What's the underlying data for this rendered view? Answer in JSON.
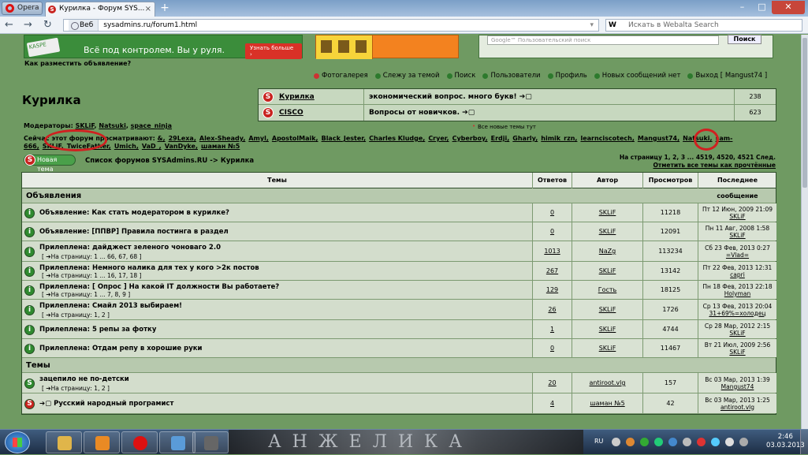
{
  "browser": {
    "opera_label": "Opera",
    "tab_title": "Курилка - Форум SYS...",
    "tab_close": "×",
    "new_tab": "+",
    "address_scheme": "Веб",
    "address": "sysadmins.ru/forum1.html",
    "search_engine": "W",
    "search_placeholder": "Искать в Webalta Search",
    "window_controls": {
      "minimize": "–",
      "maximize": "□",
      "close": "✕"
    },
    "nav": {
      "back": "←",
      "forward": "→",
      "reload": "↻"
    }
  },
  "ads": {
    "green_logo": "KASPE",
    "green_title": "Всё под контролем. Вы у руля.",
    "green_button": "Узнать больше ›",
    "how_to_place": "Как разместить объявление?",
    "google_placeholder": "Google™ Пользовательский поиск",
    "google_button": "Поиск"
  },
  "topnav": [
    {
      "label": "Фотогалерея",
      "dot": "r"
    },
    {
      "label": "Слежу за темой",
      "dot": "g"
    },
    {
      "label": "Поиск",
      "dot": "g"
    },
    {
      "label": "Пользователи",
      "dot": "g"
    },
    {
      "label": "Профиль",
      "dot": "g"
    },
    {
      "label": "Новых сообщений нет",
      "dot": "g"
    },
    {
      "label": "Выход [ Mangust74 ]",
      "dot": "g"
    }
  ],
  "forum_title": "Курилка",
  "subforums": [
    {
      "name": "Курилка",
      "last": "экономический вопрос. много букв! ➔▢",
      "count": "238"
    },
    {
      "name": "CISCO",
      "last": "Вопросы от новичков. ➔▢",
      "count": "623"
    }
  ],
  "new_topics_note": "Все новые темы тут",
  "moderators_label": "Модераторы:",
  "moderators": [
    "SKLiF",
    "Natsuki",
    "space_ninja"
  ],
  "viewers_label": "Сейчас этот форум просматривают:",
  "viewers": [
    "&",
    "29Lexa",
    "Alex-Sheady",
    "Amyl",
    "ApostolMaik",
    "Black_Jester",
    "Charles Kludge",
    "Cryer",
    "Cyberboy",
    "Erdji",
    "Gharly",
    "himik_rzn",
    "learnciscotech",
    "Mangust74",
    "Natsuki",
    "sam-666",
    "SKLiF",
    "TwiceFather",
    "Umich",
    "VaD_",
    "VanDyke",
    "шаман №5"
  ],
  "new_topic_label": "Новая тема",
  "breadcrumb": "Список форумов SYSAdmins.RU -> Курилка",
  "pager": {
    "text": "На страницу 1, 2, 3 ... 4519, 4520, 4521 След.",
    "mark_read": "Отметить все темы как прочтённые"
  },
  "columns": {
    "topics": "Темы",
    "replies": "Ответов",
    "author": "Автор",
    "views": "Просмотров",
    "last": "Последнее сообщение"
  },
  "section_announcements": "Объявления",
  "section_topics": "Темы",
  "rows": [
    {
      "icon": "i",
      "color": "g",
      "title": "Объявление: Как стать модератором в курилке?",
      "pages": "",
      "replies": "0",
      "author": "SKLiF",
      "views": "11218",
      "last_date": "Пт 12 Июн, 2009 21:09",
      "last_user": "SKLiF"
    },
    {
      "icon": "i",
      "color": "g",
      "title": "Объявление: [ППВР] Правила постинга в раздел",
      "pages": "",
      "replies": "0",
      "author": "SKLiF",
      "views": "12091",
      "last_date": "Пн 11 Авг, 2008 1:58",
      "last_user": "SKLiF"
    },
    {
      "icon": "i",
      "color": "g",
      "title": "Прилеплена: дайджест зеленого чоноваго 2.0",
      "pages": "[ ➔На страницу: 1 ... 66, 67, 68 ]",
      "replies": "1013",
      "author": "NaZg",
      "views": "113234",
      "last_date": "Сб 23 Фев, 2013 0:27",
      "last_user": "=Vlad="
    },
    {
      "icon": "i",
      "color": "g",
      "title": "Прилеплена: Немного налика для тех у кого >2к постов",
      "pages": "[ ➔На страницу: 1 ... 16, 17, 18 ]",
      "replies": "267",
      "author": "SKLiF",
      "views": "13142",
      "last_date": "Пт 22 Фев, 2013 12:31",
      "last_user": "capri"
    },
    {
      "icon": "i",
      "color": "g",
      "title": "Прилеплена: [ Опрос ] На какой IT должности Вы работаете?",
      "pages": "[ ➔На страницу: 1 ... 7, 8, 9 ]",
      "replies": "129",
      "author": "Гость",
      "views": "18125",
      "last_date": "Пн 18 Фев, 2013 22:18",
      "last_user": "Holyman"
    },
    {
      "icon": "i",
      "color": "g",
      "title": "Прилеплена: Смайл 2013 выбираем!",
      "pages": "[ ➔На страницу: 1, 2 ]",
      "replies": "26",
      "author": "SKLiF",
      "views": "1726",
      "last_date": "Ср 13 Фев, 2013 20:04",
      "last_user": "31+69%=холодец"
    },
    {
      "icon": "i",
      "color": "g",
      "title": "Прилеплена: 5 репы за фотку",
      "pages": "",
      "replies": "1",
      "author": "SKLiF",
      "views": "4744",
      "last_date": "Ср 28 Мар, 2012 2:15",
      "last_user": "SKLiF"
    },
    {
      "icon": "i",
      "color": "g",
      "title": "Прилеплена: Отдам репу в хорошие руки",
      "pages": "",
      "replies": "0",
      "author": "SKLiF",
      "views": "11467",
      "last_date": "Вт 21 Июл, 2009 2:56",
      "last_user": "SKLiF"
    },
    {
      "icon": "S",
      "color": "g",
      "title": "зацепило не по-детски",
      "pages": "[ ➔На страницу: 1, 2 ]",
      "replies": "20",
      "author": "antiroot.vlg",
      "views": "157",
      "last_date": "Вс 03 Мар, 2013 1:39",
      "last_user": "Mangust74"
    },
    {
      "icon": "S",
      "color": "r",
      "title": "➔▢ Русский народный програмист",
      "pages": "",
      "replies": "4",
      "author": "шаман №5",
      "views": "42",
      "last_date": "Вс 03 Мар, 2013 1:25",
      "last_user": "antiroot.vlg"
    }
  ],
  "taskbar": {
    "wallpaper_text": "АНЖЕЛИКА",
    "lang": "RU",
    "time": "2:46",
    "date": "03.03.2013"
  }
}
